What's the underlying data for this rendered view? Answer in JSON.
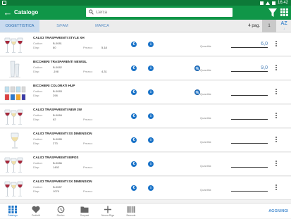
{
  "statusbar": {
    "time": "16:42"
  },
  "appbar": {
    "title": "Catalogo",
    "search_placeholder": "Cerca"
  },
  "tabs": [
    {
      "label": "OGGETTISTICA",
      "active": true
    },
    {
      "label": "S/FAM",
      "active": false
    },
    {
      "label": "MARCA",
      "active": false
    }
  ],
  "pagination": {
    "pages_label": "4 pag.",
    "current": "1",
    "sort_label": "AZ"
  },
  "product_fields": {
    "codice": "Codice:",
    "disp": "Disp:",
    "prezzo": "Prezzo:",
    "quantita": "Quantità:"
  },
  "products": [
    {
      "name": "CALICI TRASPARENTI STYLE XH",
      "codice": "B-0081",
      "disp": "80",
      "prezzo": "5,18",
      "quantita": "6,0",
      "show_prezzo": true,
      "discount": false,
      "image": "wine-glasses"
    },
    {
      "name": "BICCHIERI TRASPARENTI NEWSIL",
      "codice": "B-0082",
      "disp": "-198",
      "prezzo": "4,31",
      "quantita": "9,0",
      "show_prezzo": true,
      "discount": true,
      "image": "tall-glasses"
    },
    {
      "name": "BICCHIERI COLORATI HUP",
      "codice": "B-0083",
      "disp": "298",
      "prezzo": "",
      "quantita": "",
      "show_prezzo": false,
      "discount": true,
      "image": "colored-tumblers"
    },
    {
      "name": "CALICI TRASPARENTI NEW 3W",
      "codice": "B-0084",
      "disp": "62",
      "prezzo": "",
      "quantita": "",
      "show_prezzo": true,
      "discount": false,
      "image": "wine-glasses"
    },
    {
      "name": "CALICI TRASPARENTI SS DIMENSION",
      "codice": "B-0085",
      "disp": "273",
      "prezzo": "",
      "quantita": "",
      "show_prezzo": true,
      "discount": false,
      "image": "single-glass"
    },
    {
      "name": "CALICI TRASPARENTI BIPOS",
      "codice": "B-0086",
      "disp": "1492",
      "prezzo": "",
      "quantita": "",
      "show_prezzo": true,
      "discount": false,
      "image": "wine-glasses"
    },
    {
      "name": "CALICI TRASPARENTI SX DIMENSION",
      "codice": "B-0087",
      "disp": "1079",
      "prezzo": "",
      "quantita": "",
      "show_prezzo": true,
      "discount": false,
      "image": "wine-glasses"
    }
  ],
  "bottom_nav": [
    {
      "label": "Catalogo",
      "icon": "grid-icon",
      "active": true
    },
    {
      "label": "Preferiti",
      "icon": "heart-icon",
      "active": false
    },
    {
      "label": "Storico",
      "icon": "history-icon",
      "active": false
    },
    {
      "label": "Sospesi",
      "icon": "folder-icon",
      "active": false
    },
    {
      "label": "Nuova Riga",
      "icon": "plus-icon",
      "active": false
    },
    {
      "label": "Barcode",
      "icon": "barcode-icon",
      "active": false
    }
  ],
  "add_label": "AGGIUNGI",
  "colors": {
    "primary_green": "#109648",
    "status_green": "#0d7a38",
    "accent_blue": "#1a73c8"
  }
}
